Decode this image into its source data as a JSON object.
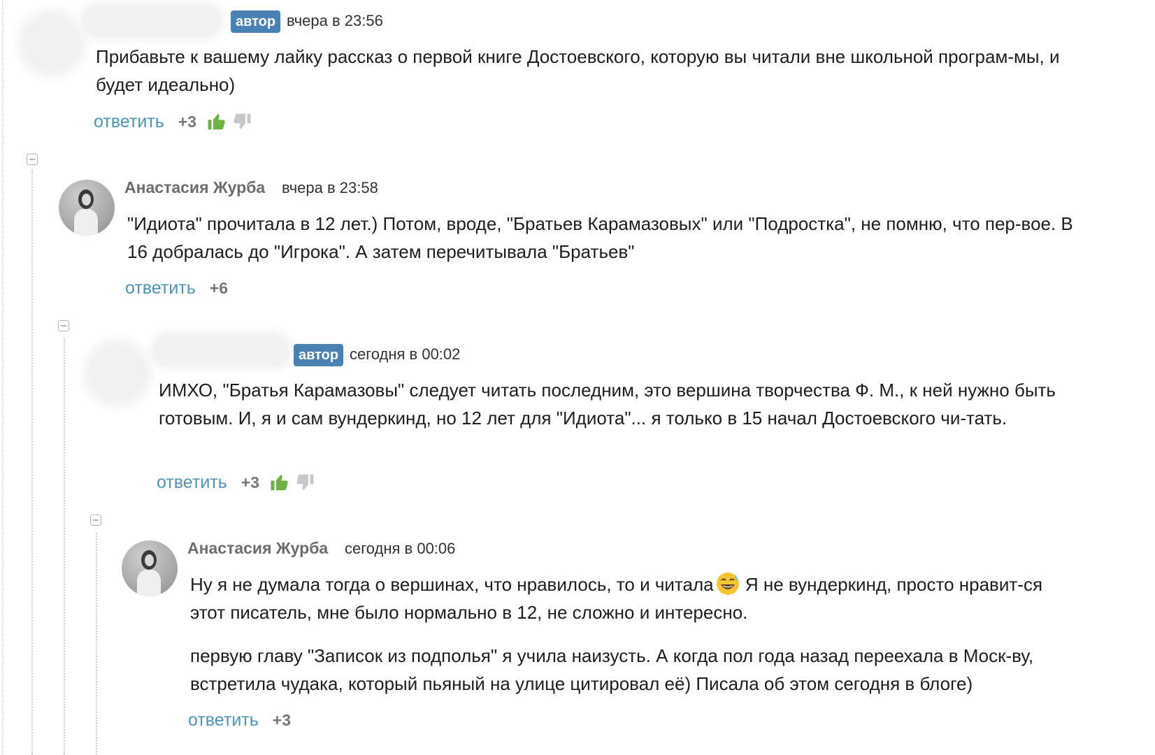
{
  "comments": [
    {
      "badge": "автор",
      "time": "вчера в 23:56",
      "text": "Прибавьте к вашему лайку рассказ о первой книге Достоевского, которую вы читали вне школьной програм-мы, и будет идеально)",
      "reply_label": "ответить",
      "score": "+3"
    },
    {
      "author": "Анастасия Журба",
      "time": "вчера в 23:58",
      "text": "\"Идиота\" прочитала в 12 лет.) Потом, вроде, \"Братьев Карамазовых\" или \"Подростка\", не помню, что пер-вое. В 16 добралась до \"Игрока\".  А затем перечитывала \"Братьев\"",
      "reply_label": "ответить",
      "score": "+6"
    },
    {
      "badge": "автор",
      "time": "сегодня в 00:02",
      "text": "ИМХО, \"Братья Карамазовы\" следует читать последним, это вершина творчества Ф. М., к ней нужно быть готовым. И, я и сам вундеркинд, но 12 лет для \"Идиота\"... я только в 15 начал Достоевского чи-тать.",
      "reply_label": "ответить",
      "score": "+3"
    },
    {
      "author": "Анастасия Журба",
      "time": "сегодня в 00:06",
      "text_a": "Ну я не думала тогда о вершинах, что нравилось, то и читала",
      "text_b": " Я не вундеркинд, просто нравит-ся этот писатель, мне было нормально в 12, не сложно и интересно.",
      "text_2": "первую главу \"Записок из подполья\" я учила наизусть. А когда пол года назад переехала в Моск-ву, встретила чудака, который пьяный на улице цитировал её) Писала об этом сегодня в блоге)",
      "reply_label": "ответить",
      "score": "+3"
    }
  ],
  "colors": {
    "badge": "#4a81b3",
    "reply_link": "#4f94b8",
    "thumb_up": "#6cb33f",
    "thumb_down": "#c8c8c8"
  },
  "icons": [
    "minus-square-icon",
    "thumbs-up-icon",
    "thumbs-down-icon",
    "sweat-smile-emoji-icon"
  ]
}
